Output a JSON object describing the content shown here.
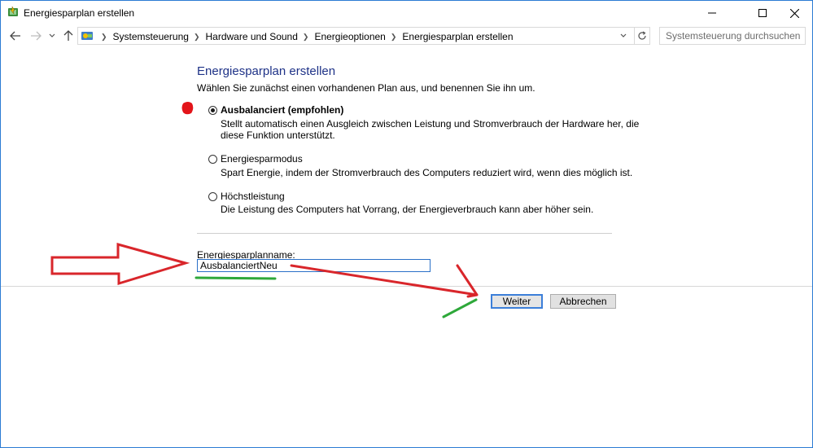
{
  "window": {
    "title": "Energiesparplan erstellen",
    "icon": "power-options-icon",
    "controls": [
      "minimize-icon",
      "maximize-icon",
      "close-icon"
    ]
  },
  "navigation": {
    "back_icon": "back-arrow-icon",
    "forward_icon": "forward-arrow-icon",
    "recent_icon": "chevron-down-icon",
    "up_icon": "up-arrow-icon",
    "breadcrumbs": [
      "Systemsteuerung",
      "Hardware und Sound",
      "Energieoptionen",
      "Energiesparplan erstellen"
    ],
    "search_placeholder": "Systemsteuerung durchsuchen"
  },
  "main": {
    "title": "Energiesparplan erstellen",
    "instruction": "Wählen Sie zunächst einen vorhandenen Plan aus, und benennen Sie ihn um.",
    "plans": [
      {
        "label": "Ausbalanciert (empfohlen)",
        "selected": true,
        "description_line1": "Stellt automatisch einen Ausgleich zwischen Leistung und Stromverbrauch der Hardware her, die",
        "description_line2": "diese Funktion unterstützt."
      },
      {
        "label": "Energiesparmodus",
        "selected": false,
        "description_line1": "Spart Energie, indem der Stromverbrauch des Computers reduziert wird, wenn dies möglich ist."
      },
      {
        "label": "Höchstleistung",
        "selected": false,
        "description_line1": "Die Leistung des Computers hat Vorrang, der Energieverbrauch kann aber höher sein."
      }
    ],
    "plan_name_label": "Energiesparplanname:",
    "plan_name_value": "AusbalanciertNeu"
  },
  "buttons": {
    "next": "Weiter",
    "cancel": "Abbrechen"
  },
  "colors": {
    "title_blue": "#1e3287",
    "window_border": "#2b7bd4",
    "annotation_red": "#d9262b",
    "annotation_green": "#2ea83a"
  }
}
